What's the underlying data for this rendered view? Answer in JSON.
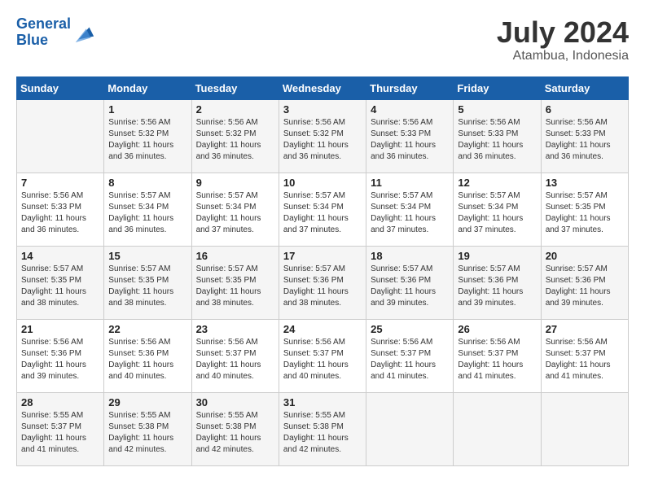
{
  "header": {
    "logo_line1": "General",
    "logo_line2": "Blue",
    "month": "July 2024",
    "location": "Atambua, Indonesia"
  },
  "days_of_week": [
    "Sunday",
    "Monday",
    "Tuesday",
    "Wednesday",
    "Thursday",
    "Friday",
    "Saturday"
  ],
  "weeks": [
    [
      {
        "day": "",
        "info": ""
      },
      {
        "day": "1",
        "info": "Sunrise: 5:56 AM\nSunset: 5:32 PM\nDaylight: 11 hours\nand 36 minutes."
      },
      {
        "day": "2",
        "info": "Sunrise: 5:56 AM\nSunset: 5:32 PM\nDaylight: 11 hours\nand 36 minutes."
      },
      {
        "day": "3",
        "info": "Sunrise: 5:56 AM\nSunset: 5:32 PM\nDaylight: 11 hours\nand 36 minutes."
      },
      {
        "day": "4",
        "info": "Sunrise: 5:56 AM\nSunset: 5:33 PM\nDaylight: 11 hours\nand 36 minutes."
      },
      {
        "day": "5",
        "info": "Sunrise: 5:56 AM\nSunset: 5:33 PM\nDaylight: 11 hours\nand 36 minutes."
      },
      {
        "day": "6",
        "info": "Sunrise: 5:56 AM\nSunset: 5:33 PM\nDaylight: 11 hours\nand 36 minutes."
      }
    ],
    [
      {
        "day": "7",
        "info": "Sunrise: 5:56 AM\nSunset: 5:33 PM\nDaylight: 11 hours\nand 36 minutes."
      },
      {
        "day": "8",
        "info": "Sunrise: 5:57 AM\nSunset: 5:34 PM\nDaylight: 11 hours\nand 36 minutes."
      },
      {
        "day": "9",
        "info": "Sunrise: 5:57 AM\nSunset: 5:34 PM\nDaylight: 11 hours\nand 37 minutes."
      },
      {
        "day": "10",
        "info": "Sunrise: 5:57 AM\nSunset: 5:34 PM\nDaylight: 11 hours\nand 37 minutes."
      },
      {
        "day": "11",
        "info": "Sunrise: 5:57 AM\nSunset: 5:34 PM\nDaylight: 11 hours\nand 37 minutes."
      },
      {
        "day": "12",
        "info": "Sunrise: 5:57 AM\nSunset: 5:34 PM\nDaylight: 11 hours\nand 37 minutes."
      },
      {
        "day": "13",
        "info": "Sunrise: 5:57 AM\nSunset: 5:35 PM\nDaylight: 11 hours\nand 37 minutes."
      }
    ],
    [
      {
        "day": "14",
        "info": "Sunrise: 5:57 AM\nSunset: 5:35 PM\nDaylight: 11 hours\nand 38 minutes."
      },
      {
        "day": "15",
        "info": "Sunrise: 5:57 AM\nSunset: 5:35 PM\nDaylight: 11 hours\nand 38 minutes."
      },
      {
        "day": "16",
        "info": "Sunrise: 5:57 AM\nSunset: 5:35 PM\nDaylight: 11 hours\nand 38 minutes."
      },
      {
        "day": "17",
        "info": "Sunrise: 5:57 AM\nSunset: 5:36 PM\nDaylight: 11 hours\nand 38 minutes."
      },
      {
        "day": "18",
        "info": "Sunrise: 5:57 AM\nSunset: 5:36 PM\nDaylight: 11 hours\nand 39 minutes."
      },
      {
        "day": "19",
        "info": "Sunrise: 5:57 AM\nSunset: 5:36 PM\nDaylight: 11 hours\nand 39 minutes."
      },
      {
        "day": "20",
        "info": "Sunrise: 5:57 AM\nSunset: 5:36 PM\nDaylight: 11 hours\nand 39 minutes."
      }
    ],
    [
      {
        "day": "21",
        "info": "Sunrise: 5:56 AM\nSunset: 5:36 PM\nDaylight: 11 hours\nand 39 minutes."
      },
      {
        "day": "22",
        "info": "Sunrise: 5:56 AM\nSunset: 5:36 PM\nDaylight: 11 hours\nand 40 minutes."
      },
      {
        "day": "23",
        "info": "Sunrise: 5:56 AM\nSunset: 5:37 PM\nDaylight: 11 hours\nand 40 minutes."
      },
      {
        "day": "24",
        "info": "Sunrise: 5:56 AM\nSunset: 5:37 PM\nDaylight: 11 hours\nand 40 minutes."
      },
      {
        "day": "25",
        "info": "Sunrise: 5:56 AM\nSunset: 5:37 PM\nDaylight: 11 hours\nand 41 minutes."
      },
      {
        "day": "26",
        "info": "Sunrise: 5:56 AM\nSunset: 5:37 PM\nDaylight: 11 hours\nand 41 minutes."
      },
      {
        "day": "27",
        "info": "Sunrise: 5:56 AM\nSunset: 5:37 PM\nDaylight: 11 hours\nand 41 minutes."
      }
    ],
    [
      {
        "day": "28",
        "info": "Sunrise: 5:55 AM\nSunset: 5:37 PM\nDaylight: 11 hours\nand 41 minutes."
      },
      {
        "day": "29",
        "info": "Sunrise: 5:55 AM\nSunset: 5:38 PM\nDaylight: 11 hours\nand 42 minutes."
      },
      {
        "day": "30",
        "info": "Sunrise: 5:55 AM\nSunset: 5:38 PM\nDaylight: 11 hours\nand 42 minutes."
      },
      {
        "day": "31",
        "info": "Sunrise: 5:55 AM\nSunset: 5:38 PM\nDaylight: 11 hours\nand 42 minutes."
      },
      {
        "day": "",
        "info": ""
      },
      {
        "day": "",
        "info": ""
      },
      {
        "day": "",
        "info": ""
      }
    ]
  ]
}
